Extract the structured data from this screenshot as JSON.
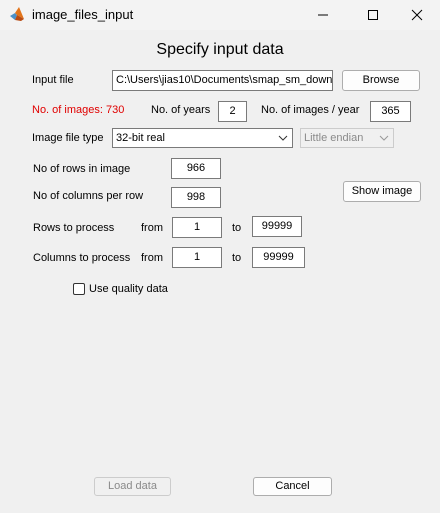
{
  "window": {
    "title": "image_files_input"
  },
  "heading": "Specify input data",
  "input_file": {
    "label": "Input file",
    "value": "C:\\Users\\jias10\\Documents\\smap_sm_downl",
    "browse_label": "Browse"
  },
  "counts": {
    "num_images_text": "No. of images: 730",
    "num_years_label": "No. of years",
    "num_years_value": "2",
    "images_per_year_label": "No. of images / year",
    "images_per_year_value": "365"
  },
  "image_type": {
    "label": "Image file type",
    "selected": "32-bit real",
    "endian_selected": "Little endian"
  },
  "rows": {
    "label": "No of rows in image",
    "value": "966"
  },
  "columns": {
    "label": "No of columns per row",
    "value": "998"
  },
  "show_image_label": "Show image",
  "rows_process": {
    "label": "Rows to process",
    "from_label": "from",
    "from_value": "1",
    "to_label": "to",
    "to_value": "99999"
  },
  "cols_process": {
    "label": "Columns to process",
    "from_label": "from",
    "from_value": "1",
    "to_label": "to",
    "to_value": "99999"
  },
  "quality": {
    "label": "Use quality data",
    "checked": false
  },
  "buttons": {
    "load_label": "Load data",
    "cancel_label": "Cancel"
  },
  "colors": {
    "warning_text": "#e00000",
    "background": "#f0f0f0"
  },
  "icons": {
    "minimize": "minimize-icon",
    "maximize": "maximize-icon",
    "close": "close-icon"
  }
}
